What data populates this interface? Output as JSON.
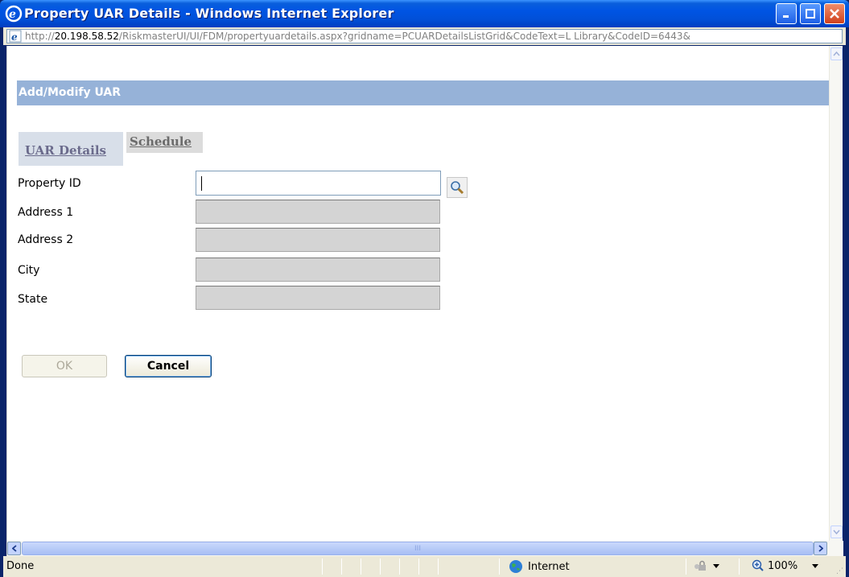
{
  "window": {
    "title": "Property UAR Details - Windows Internet Explorer",
    "buttons": {
      "minimize": "minimize-icon",
      "maximize": "maximize-icon",
      "close": "close-icon"
    }
  },
  "address": {
    "protocol": "http://",
    "host": "20.198.58.52",
    "path": "/RiskmasterUI/UI/FDM/propertyuardetails.aspx?gridname=PCUARDetailsListGrid&CodeText=L Library&CodeID=6443&"
  },
  "form": {
    "header": "Add/Modify UAR",
    "tabs": [
      {
        "label": "UAR Details",
        "active": true
      },
      {
        "label": "Schedule",
        "active": false
      }
    ],
    "fields": [
      {
        "label": "Property ID",
        "value": "",
        "enabled": true
      },
      {
        "label": "Address 1",
        "value": "",
        "enabled": false
      },
      {
        "label": "Address 2",
        "value": "",
        "enabled": false
      },
      {
        "label": "City",
        "value": "",
        "enabled": false
      },
      {
        "label": "State",
        "value": "",
        "enabled": false
      }
    ],
    "ok_label": "OK",
    "cancel_label": "Cancel"
  },
  "scroll": {
    "thumb_grip": "III"
  },
  "status": {
    "text": "Done",
    "zone": "Internet",
    "zoom": "100%"
  },
  "colors": {
    "titlebar": "#0054e3",
    "form_header": "#96b2d8",
    "disabled_field": "#d4d4d4"
  }
}
